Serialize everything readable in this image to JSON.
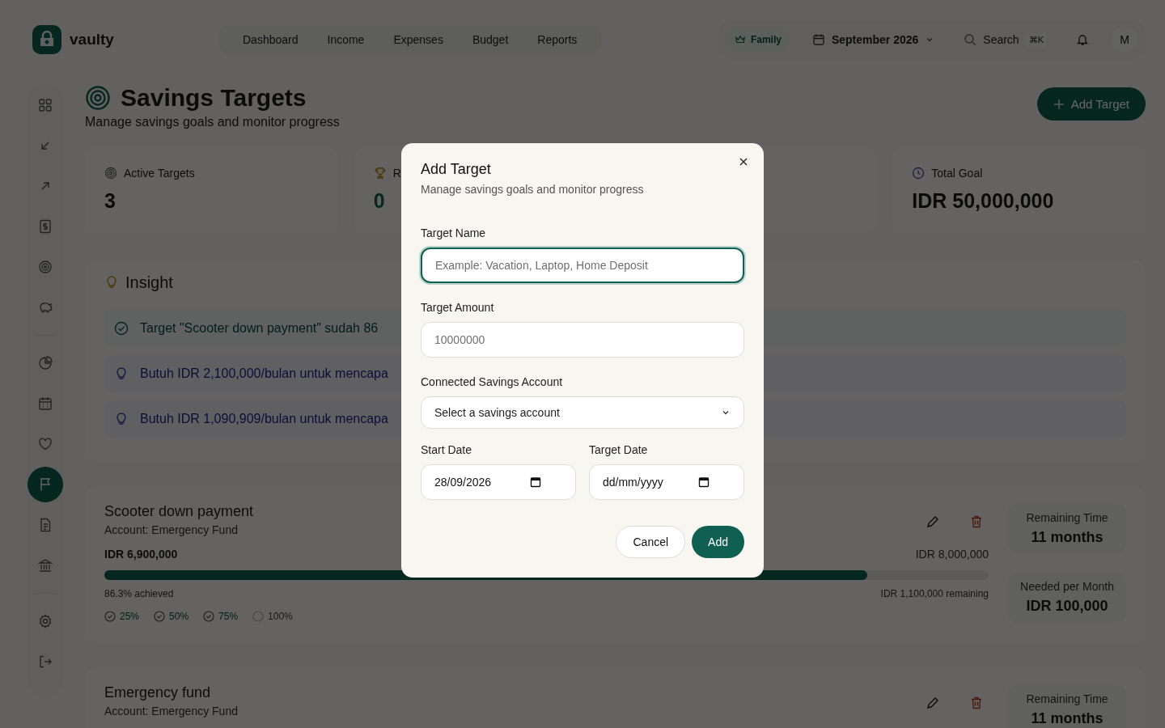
{
  "brand": {
    "name": "vaulty"
  },
  "nav": [
    {
      "label": "Dashboard",
      "selected": false
    },
    {
      "label": "Income",
      "selected": false
    },
    {
      "label": "Expenses",
      "selected": false
    },
    {
      "label": "Budget",
      "selected": false
    },
    {
      "label": "Reports",
      "selected": false
    }
  ],
  "header": {
    "plan": "Family",
    "period": "September 2026",
    "search": "Search",
    "shortcut": "⌘K",
    "avatar": "M"
  },
  "sidebar": {
    "groups": [
      [
        {
          "kind": "grid",
          "selected": false
        },
        {
          "kind": "in",
          "selected": false
        },
        {
          "kind": "out",
          "selected": false
        },
        {
          "kind": "bill",
          "selected": false
        },
        {
          "kind": "target",
          "selected": false
        },
        {
          "kind": "piggy",
          "selected": false
        }
      ],
      [
        {
          "kind": "pie",
          "selected": false
        },
        {
          "kind": "calendar",
          "selected": false
        },
        {
          "kind": "heart",
          "selected": false
        },
        {
          "kind": "flag",
          "selected": true
        },
        {
          "kind": "doc",
          "selected": false
        },
        {
          "kind": "bank",
          "selected": false
        }
      ],
      [
        {
          "kind": "gear",
          "selected": false
        },
        {
          "kind": "logout",
          "selected": false
        }
      ]
    ]
  },
  "page": {
    "title": "Savings Targets",
    "subtitle": "Manage savings goals and monitor progress",
    "add_button": "Add Target"
  },
  "stats": [
    {
      "kind": "active",
      "label": "Active Targets",
      "value": "3"
    },
    {
      "kind": "reached",
      "label": "R",
      "value": "0"
    },
    {
      "kind": "hidden"
    },
    {
      "kind": "total",
      "label": "Total Goal",
      "value": "IDR 50,000,000"
    }
  ],
  "insight": {
    "title": "Insight",
    "items": [
      {
        "kind": "success",
        "text": "Target \"Scooter down payment\" sudah 86"
      },
      {
        "kind": "tip",
        "text": "Butuh IDR 2,100,000/bulan untuk mencapa"
      },
      {
        "kind": "tip",
        "text": "Butuh IDR 1,090,909/bulan untuk mencapa"
      }
    ]
  },
  "targets": [
    {
      "name": "Scooter down payment",
      "account": "Account: Emergency Fund",
      "saved": "IDR 6,900,000",
      "goal": "IDR 8,000,000",
      "level": 0.863,
      "achieved": "86.3% achieved",
      "remaining": "IDR 1,100,000 remaining",
      "milestones": [
        {
          "label": "25%",
          "checked": true
        },
        {
          "label": "50%",
          "checked": true
        },
        {
          "label": "75%",
          "checked": true
        },
        {
          "label": "100%",
          "checked": false
        }
      ],
      "remaining_time_label": "Remaining Time",
      "remaining_time": "11 months",
      "needed_label": "Needed per Month",
      "needed": "IDR 100,000"
    },
    {
      "name": "Emergency fund",
      "account": "Account: Emergency Fund",
      "remaining_time_label": "Remaining Time",
      "remaining_time": "11 months"
    }
  ],
  "dialog": {
    "title": "Add Target",
    "subtitle": "Manage savings goals and monitor progress",
    "fields": [
      {
        "kind": "text",
        "label": "Target Name",
        "placeholder": "Example: Vacation, Laptop, Home Deposit",
        "focused": true
      },
      {
        "kind": "text",
        "label": "Target Amount",
        "placeholder": "10000000",
        "focused": false
      },
      {
        "kind": "select",
        "label": "Connected Savings Account",
        "value": "Select a savings account",
        "focused": false
      }
    ],
    "dates": [
      {
        "label": "Start Date",
        "value": "28/09/2026"
      },
      {
        "label": "Target Date",
        "placeholder": "dd/mm/yyyy"
      }
    ],
    "buttons": [
      {
        "kind": "secondary",
        "label": "Cancel"
      },
      {
        "kind": "primary",
        "label": "Add"
      }
    ]
  }
}
